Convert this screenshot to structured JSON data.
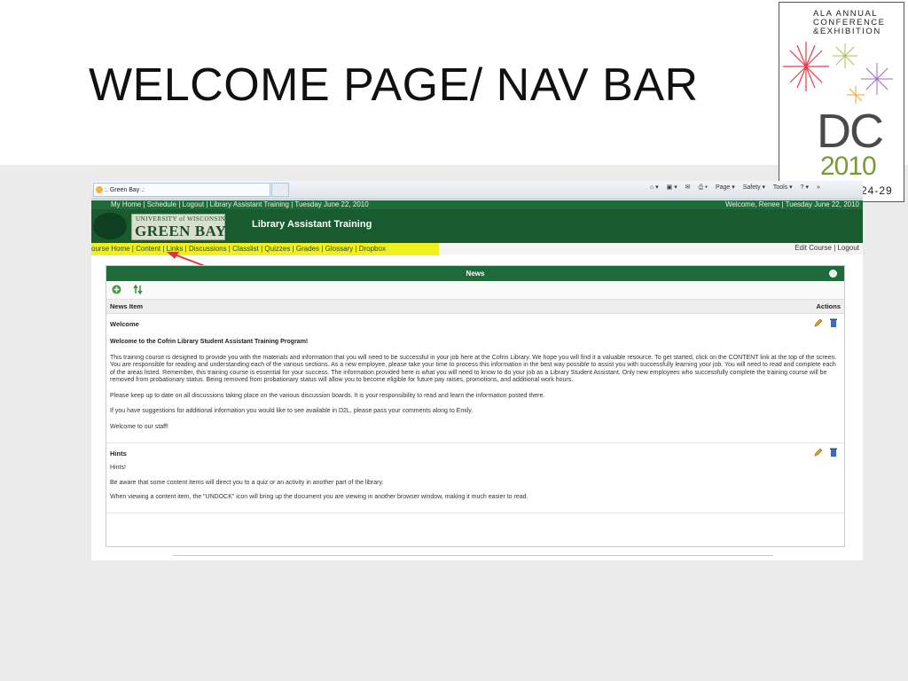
{
  "slide": {
    "title": "WELCOME PAGE/ NAV BAR"
  },
  "ala": {
    "line1": "ALA ANNUAL",
    "line2": "CONFERENCE",
    "line3": "&EXHIBITION",
    "dc": "DC",
    "year": "2010",
    "dates": "24-29",
    "colors": {
      "green": "#7a9a3a",
      "gray": "#4a4a4a"
    }
  },
  "browser": {
    "tab_title": ":. Green Bay .:",
    "tools": [
      "Page ▾",
      "Safety ▾",
      "Tools ▾"
    ]
  },
  "d2l": {
    "top_left": "My Home | Schedule | Logout | Library Assistant Training | Tuesday June 22, 2010",
    "top_right": "Welcome, Renee | Tuesday June 22, 2010",
    "logo_small": "UNIVERSITY of WISCONSIN",
    "logo_big": "GREEN BAY",
    "course_title": "Library Assistant Training",
    "nav_items": [
      "ourse Home",
      "Content",
      "Links",
      "Discussions",
      "Classlist",
      "Quizzes",
      "Grades",
      "Glossary",
      "Dropbox"
    ],
    "nav_right": "Edit Course | Logout",
    "colors": {
      "green": "#1e6a3a",
      "highlight": "#f0f020",
      "arrow": "#d9373a"
    }
  },
  "news": {
    "header": "News",
    "col_item": "News Item",
    "col_actions": "Actions",
    "items": [
      {
        "title": "Welcome",
        "paras": [
          "Welcome to the Cofrin Library Student Assistant Training Program!",
          "This training course is designed to provide you with the materials and information that you will need to be successful in your job here at the Cofrin Library. We hope you will find it a valuable resource. To get started, click on the CONTENT link at the top of the screen. You are responsible for reading and understanding each of the various sections. As a new employee, please take your time to process this information in the best way possible to assist you with successfully learning your job. You will need to read and complete each of the areas listed. Remember, this training course is essential for your success. The information provided here is what you will need to know to do your job as a Library Student Assistant. Only new employees who successfully complete the training course will be removed from probationary status. Being removed from probationary status will allow you to become eligible for future pay raises, promotions, and additional work hours.",
          "Please keep up to date on all discussions taking place on the various discussion boards. It is your responsibility to read and learn the information posted there.",
          "If you have suggestions for additional information you would like to see available in D2L, please pass your comments along to Emily.",
          "Welcome to our staff!"
        ]
      },
      {
        "title": "Hints",
        "paras": [
          "Hints!",
          "Be aware that some content items will direct you to a quiz or an activity in another part of the library.",
          "When viewing a content item, the \"UNDOCK\" icon will bring up the document you are viewing in another browser window, making it much easier to read."
        ]
      }
    ]
  }
}
